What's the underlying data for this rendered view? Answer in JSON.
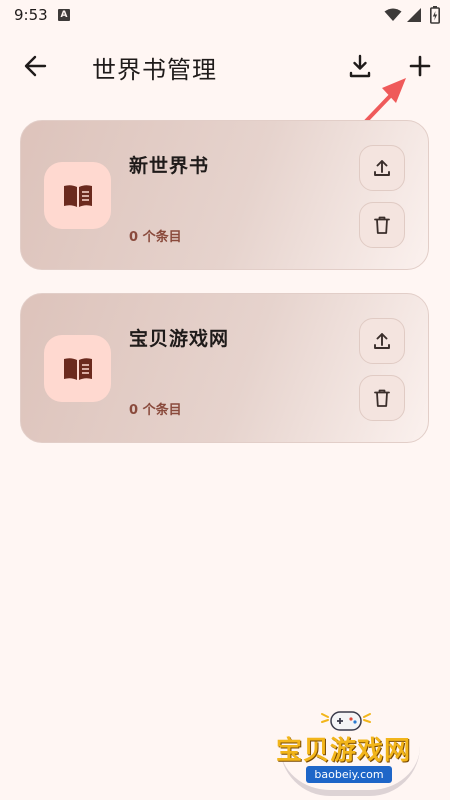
{
  "status_bar": {
    "time": "9:53",
    "app_icon_letter": "A"
  },
  "app_bar": {
    "title": "世界书管理",
    "back_icon": "arrow-left-icon",
    "import_icon": "download-icon",
    "add_icon": "plus-icon"
  },
  "worldbooks": [
    {
      "name": "新世界书",
      "entry_count": "0 个条目"
    },
    {
      "name": "宝贝游戏网",
      "entry_count": "0 个条目"
    }
  ],
  "watermark": {
    "brand": "宝贝游戏网",
    "url": "baobeiy.com"
  },
  "colors": {
    "background": "#fff6f3",
    "card_tile": "#ffd9d0",
    "count_text": "#8a4a3c",
    "annotation_arrow": "#ef5a5a"
  }
}
